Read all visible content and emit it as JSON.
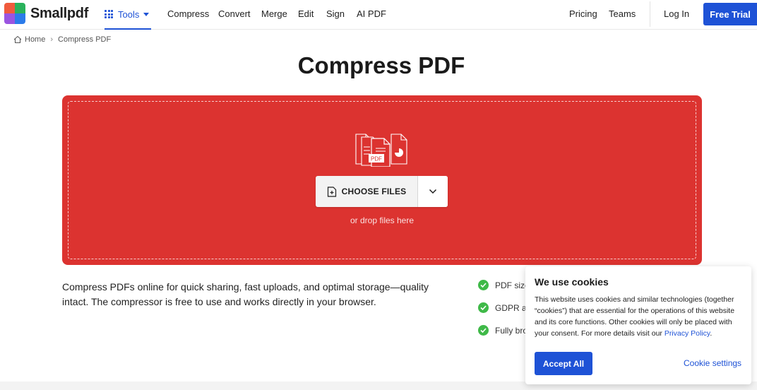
{
  "brand": {
    "name": "Smallpdf",
    "logo_colors": [
      "#f05a3c",
      "#2ab25b",
      "#9a54e0",
      "#2b7bea"
    ]
  },
  "nav": {
    "tools_label": "Tools",
    "links": [
      "Compress",
      "Convert",
      "Merge",
      "Edit",
      "Sign",
      "AI PDF"
    ],
    "right_links": [
      "Pricing",
      "Teams"
    ],
    "login_label": "Log In",
    "trial_label": "Free Trial",
    "accent_color": "#1e52d6"
  },
  "breadcrumb": {
    "home": "Home",
    "separator": "›",
    "current": "Compress PDF"
  },
  "main": {
    "title": "Compress PDF",
    "dropzone": {
      "color": "#dc3330",
      "choose_label": "CHOOSE FILES",
      "drop_hint": "or drop files here",
      "illustration_badge": "PDF"
    },
    "description": "Compress PDFs online for quick sharing, fast uploads, and optimal storage—quality intact. The compressor is free to use and works directly in your browser.",
    "features": [
      "PDF size",
      "GDPR ar",
      "Fully bro"
    ]
  },
  "cookies": {
    "title": "We use cookies",
    "text": "This website uses cookies and similar technologies (together “cookies”) that are essential for the operations of this website and its core functions. Other cookies will only be placed with your consent. For more details visit our ",
    "link_label": "Privacy Policy",
    "text_end": ".",
    "accept_label": "Accept All",
    "settings_label": "Cookie settings"
  }
}
